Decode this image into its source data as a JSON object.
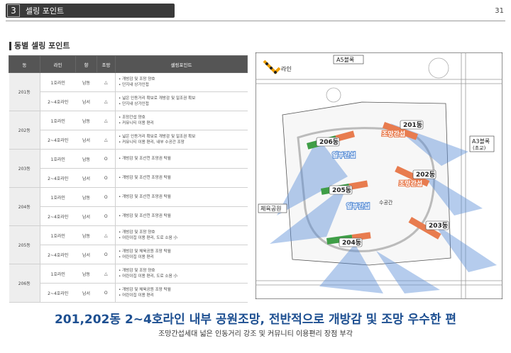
{
  "header": {
    "section_number": "3",
    "title": "셀링 포인트",
    "page_number": "31"
  },
  "section_title": "동별 셀링 포인트",
  "table": {
    "columns": [
      "동",
      "라인",
      "향",
      "조망",
      "셀링포인트"
    ],
    "groups": [
      {
        "dong": "201동",
        "rows": [
          {
            "line": "1호라인",
            "direction": "남동",
            "view": "△",
            "points": [
              "개방감 및 조망 양호",
              "단지내 상가인접"
            ]
          },
          {
            "line": "2~4호라인",
            "direction": "남서",
            "view": "△",
            "points": [
              "넓은 인동거리 확보로 개방감 및 일조권 확보",
              "단지내 상가인접"
            ]
          }
        ]
      },
      {
        "dong": "202동",
        "rows": [
          {
            "line": "1호라인",
            "direction": "남동",
            "view": "△",
            "points": [
              "조망간섭 양호",
              "커뮤니티 이용 편리"
            ]
          },
          {
            "line": "2~4호라인",
            "direction": "남서",
            "view": "△",
            "points": [
              "넓은 인동거리 확보로 개방감 및 일조권 확보",
              "커뮤니티 이용 편리, 내부 수공간 조망"
            ]
          }
        ]
      },
      {
        "dong": "203동",
        "rows": [
          {
            "line": "1호라인",
            "direction": "남동",
            "view": "O",
            "points": [
              "개방감 및 조산천 조망권 탁월"
            ]
          },
          {
            "line": "2~4호라인",
            "direction": "남서",
            "view": "O",
            "points": [
              "개방감 및 조산천 조망권 탁월"
            ]
          }
        ]
      },
      {
        "dong": "204동",
        "rows": [
          {
            "line": "1호라인",
            "direction": "남동",
            "view": "O",
            "points": [
              "개방감 및 조산천 조망권 탁월"
            ]
          },
          {
            "line": "2~4호라인",
            "direction": "남서",
            "view": "O",
            "points": [
              "개방감 및 조산천 조망권 탁월"
            ]
          }
        ]
      },
      {
        "dong": "205동",
        "rows": [
          {
            "line": "1호라인",
            "direction": "남동",
            "view": "△",
            "points": [
              "개방감 및 조망 양호",
              "어린이집 이용 편리, 도로 소음 小"
            ]
          },
          {
            "line": "2~4호라인",
            "direction": "남서",
            "view": "O",
            "points": [
              "개방감 및 체육공원 조망 탁월",
              "어린이집 이용 편리"
            ]
          }
        ]
      },
      {
        "dong": "206동",
        "rows": [
          {
            "line": "1호라인",
            "direction": "남동",
            "view": "△",
            "points": [
              "개방감 및 조망 양호",
              "어린이집 이용 편리, 도로 소음 小"
            ]
          },
          {
            "line": "2~4호라인",
            "direction": "남서",
            "view": "O",
            "points": [
              "개방감 및 체육공원 조망 탁월",
              "어린이집 이용 편리"
            ]
          }
        ]
      }
    ]
  },
  "map": {
    "legend_label": "라인",
    "block_north": "A5블록",
    "block_east": "A3블록",
    "block_east_sub": "(초교)",
    "sports_park": "체육공원",
    "water_space": "수공간",
    "buildings": [
      "201동",
      "202동",
      "203동",
      "204동",
      "205동",
      "206동"
    ],
    "view_interference": "조망간섭",
    "partial_interference": "일부간섭",
    "colors": {
      "highlight": "#e87c4f",
      "green": "#3f9e47",
      "arrow": "#5b8fd6",
      "tag_bg": "#ffffff"
    }
  },
  "headline": "201,202동 2~4호라인 내부 공원조망, 전반적으로 개방감 및 조망 우수한 편",
  "subline": "조망간섭세대 넓은 인동거리 강조 및 커뮤니티 이용편리 장점 부각"
}
